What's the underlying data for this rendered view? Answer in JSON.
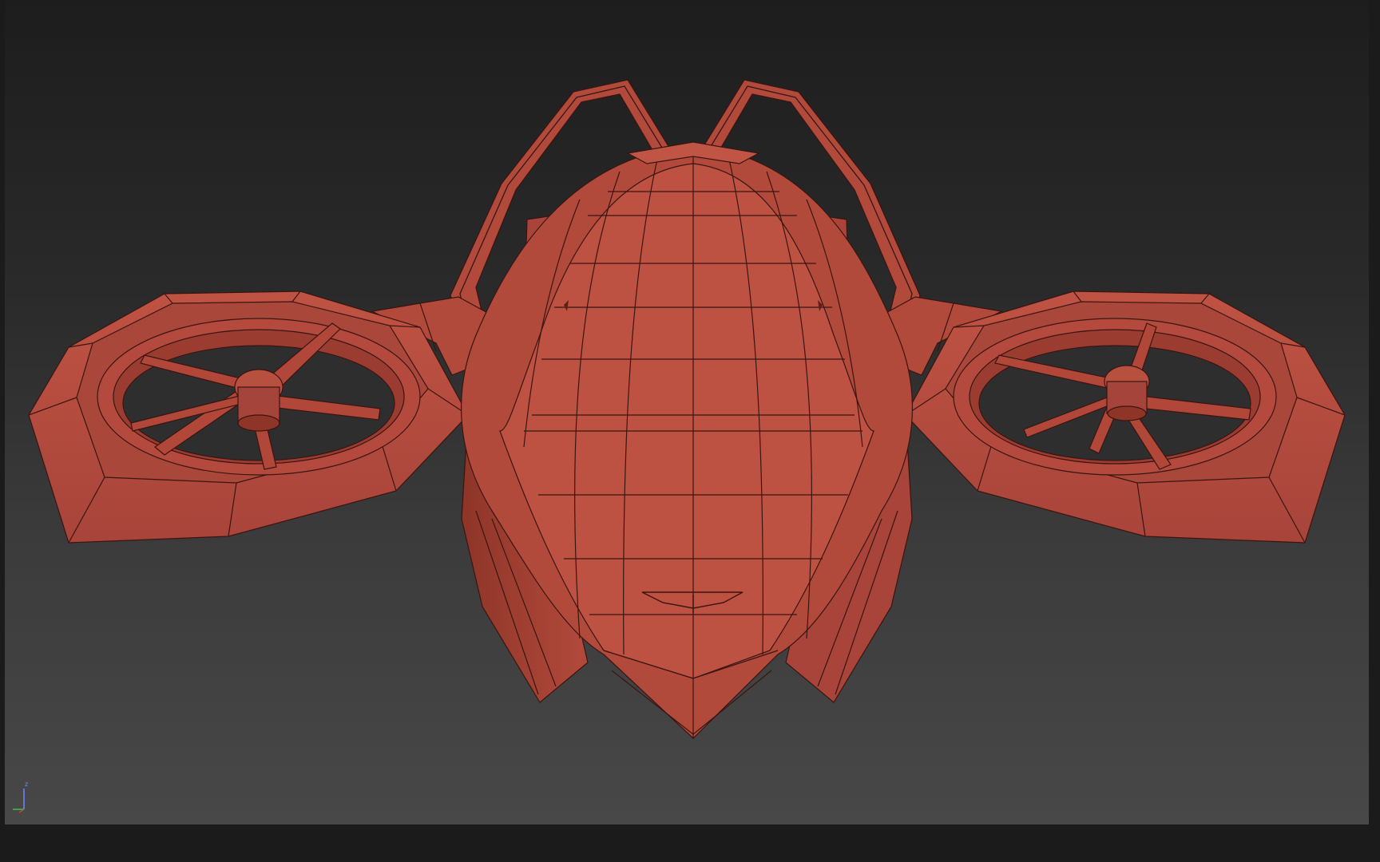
{
  "viewport": {
    "name": "3D viewport",
    "background_top": "#1d1d1d",
    "background_bottom": "#484848"
  },
  "model": {
    "color_body": "#b24a3c",
    "color_light": "#c55646",
    "color_dark": "#7e2c22",
    "wire_color": "#3a1510"
  },
  "axis_gizmo": {
    "label": "z",
    "z_color": "#6e8cff",
    "x_color": "#3fbf4f"
  }
}
